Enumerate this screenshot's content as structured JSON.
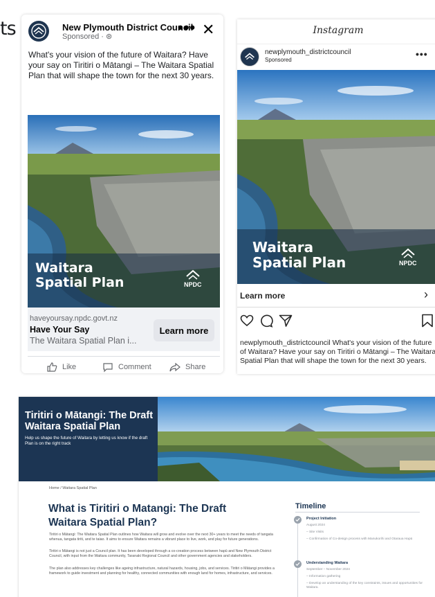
{
  "background": {
    "fragment": "ts"
  },
  "facebook_ad": {
    "page_name": "New Plymouth District Council",
    "sponsored": "Sponsored · ⊛",
    "more": "•••",
    "close": "✕",
    "primary_text": "What's your vision of the future of Waitara? Have your say on Tiritiri o Mātangi – The Waitara Spatial Plan that will shape the town for the next 30 years.",
    "image_title_line1": "Waitara",
    "image_title_line2": "Spatial Plan",
    "logo_text": "NPDC",
    "domain": "haveyoursay.npdc.govt.nz",
    "headline": "Have Your Say",
    "description": "The Waitara Spatial Plan i...",
    "cta": "Learn more",
    "actions": {
      "like": "Like",
      "comment": "Comment",
      "share": "Share"
    }
  },
  "instagram_ad": {
    "brand": "Instagram",
    "username": "newplymouth_districtcouncil",
    "sponsored": "Sponsored",
    "more": "•••",
    "image_title_line1": "Waitara",
    "image_title_line2": "Spatial Plan",
    "logo_text": "NPDC",
    "cta": "Learn more",
    "chevron": "›",
    "caption": "newplymouth_districtcouncil What's your vision of the future of Waitara? Have your say on Tiritiri o Mātangi – The Waitara Spatial Plan that will shape the town for the next 30 years."
  },
  "website": {
    "hero_title": "Tiritiri o Mātangi: The Draft Waitara Spatial Plan",
    "hero_subtitle": "Help us shape the future of Waitara by letting us know if the draft Plan is on the right track",
    "breadcrumb": "Home / Waitara Spatial Plan",
    "heading": "What is Tiritiri o Matangi: The Draft Waitara Spatial Plan?",
    "paragraphs": [
      "Tiritiri o Mātangi: The Waitara Spatial Plan outlines how Waitara will grow and evolve over the next 30+ years to meet the needs of tangata whenua, tangata tiriti, and te taiao. It aims to ensure Waitara remains a vibrant place to live, work, and play for future generations.",
      "Tiritiri o Mātangi is not just a Council plan. It has been developed through a co-creation process between hapū and New Plymouth District Council, with input from the Waitara community, Taranaki Regional Council and other government agencies and stakeholders.",
      "The plan also addresses key challenges like ageing infrastructure, natural hazards, housing, jobs, and services. Tiritiri o Mātangi provides a framework to guide investment and planning for healthy, connected communities with enough land for homes, infrastructure, and services."
    ],
    "timeline": {
      "title": "Timeline",
      "items": [
        {
          "title": "Project Initiation",
          "date": "August 2024",
          "notes": [
            "– Site Visits",
            "– Confirmation of Co-design process with Manukorihi and Otaraua Hapū"
          ]
        },
        {
          "title": "Understanding Waitara",
          "date": "September – November 2024",
          "notes": [
            "– Information gathering",
            "– Develop an understanding of the key constraints, issues and opportunities for Waitara."
          ]
        }
      ]
    }
  }
}
